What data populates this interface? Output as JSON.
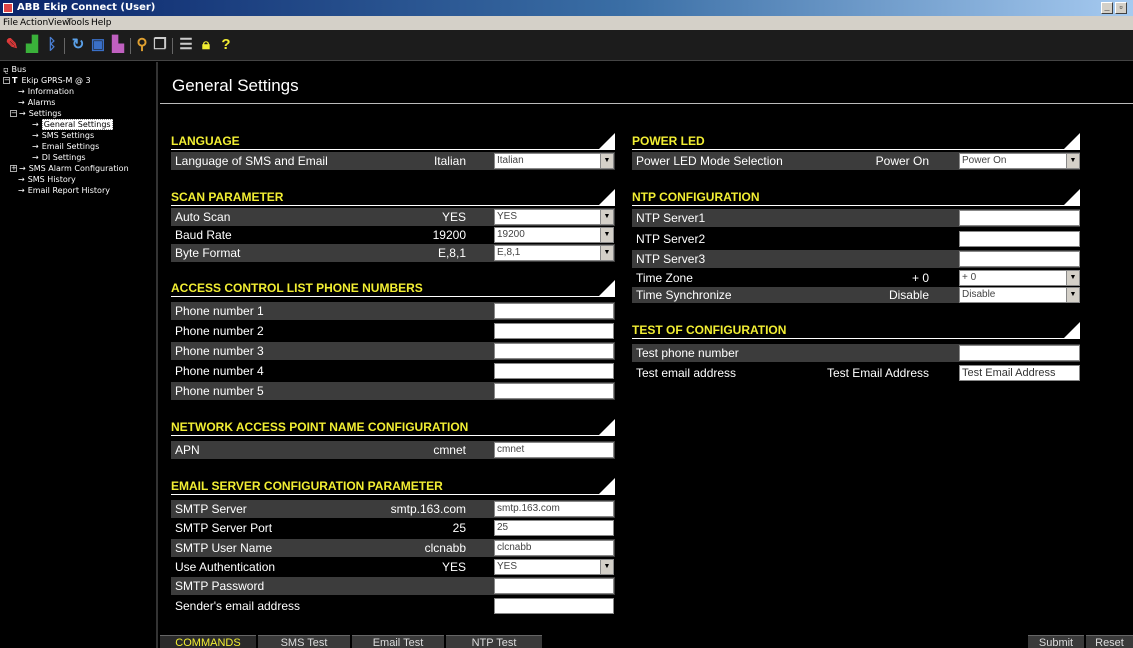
{
  "window": {
    "title": "ABB Ekip Connect (User)",
    "min_btn": "_",
    "max_btn": "▫"
  },
  "menu": [
    "File",
    "Action",
    "View",
    "Tools",
    "Help"
  ],
  "toolbar_icons": [
    "pencil-icon",
    "network-icon",
    "bluetooth-icon",
    "refresh-icon",
    "save-icon",
    "print-icon",
    "search-icon",
    "copy-icon",
    "list-icon",
    "lock-icon",
    "help-icon"
  ],
  "tree": {
    "root": "Bus",
    "device": "Ekip GPRS-M @ 3",
    "device_prefix": "T",
    "items": {
      "information": "Information",
      "alarms": "Alarms",
      "settings": "Settings",
      "general_settings": "General Settings",
      "sms_settings": "SMS Settings",
      "email_settings": "Email Settings",
      "di_settings": "DI Settings",
      "sms_alarm_config": "SMS Alarm Configuration",
      "sms_history": "SMS History",
      "email_report_history": "Email Report History"
    }
  },
  "page": {
    "title": "General Settings"
  },
  "language": {
    "title": "LANGUAGE",
    "label": "Language of SMS and Email",
    "value": "Italian",
    "selected": "Italian"
  },
  "scan": {
    "title": "SCAN PARAMETER",
    "rows": [
      {
        "label": "Auto Scan",
        "value": "YES",
        "selected": "YES"
      },
      {
        "label": "Baud Rate",
        "value": "19200",
        "selected": "19200"
      },
      {
        "label": "Byte Format",
        "value": "E,8,1",
        "selected": "E,8,1"
      }
    ]
  },
  "acl": {
    "title": "ACCESS CONTROL LIST PHONE NUMBERS",
    "rows": [
      "Phone number 1",
      "Phone number 2",
      "Phone number 3",
      "Phone number 4",
      "Phone number 5"
    ]
  },
  "apn": {
    "title": "NETWORK ACCESS POINT NAME CONFIGURATION",
    "label": "APN",
    "value": "cmnet",
    "input": "cmnet"
  },
  "email_server": {
    "title": "EMAIL SERVER CONFIGURATION PARAMETER",
    "smtp_server": {
      "label": "SMTP Server",
      "value": "smtp.163.com",
      "input": "smtp.163.com"
    },
    "smtp_port": {
      "label": "SMTP Server Port",
      "value": "25",
      "input": "25"
    },
    "smtp_user": {
      "label": "SMTP User Name",
      "value": "clcnabb",
      "input": "clcnabb"
    },
    "use_auth": {
      "label": "Use Authentication",
      "value": "YES",
      "selected": "YES"
    },
    "smtp_password": {
      "label": "SMTP Password"
    },
    "sender": {
      "label": "Sender's email address"
    }
  },
  "power_led": {
    "title": "POWER LED",
    "label": "Power LED Mode Selection",
    "value": "Power On",
    "selected": "Power On"
  },
  "ntp": {
    "title": "NTP CONFIGURATION",
    "server1": "NTP Server1",
    "server2": "NTP Server2",
    "server3": "NTP Server3",
    "timezone": {
      "label": "Time Zone",
      "value": "+ 0",
      "selected": "+ 0"
    },
    "timesync": {
      "label": "Time Synchronize",
      "value": "Disable",
      "selected": "Disable"
    }
  },
  "test_config": {
    "title": "TEST OF CONFIGURATION",
    "phone": {
      "label": "Test phone number"
    },
    "email": {
      "label": "Test email address",
      "value": "Test Email Address",
      "input": "Test Email Address"
    }
  },
  "bottom": {
    "commands": "COMMANDS",
    "sms_test": "SMS Test",
    "email_test": "Email Test",
    "ntp_test": "NTP Test",
    "submit": "Submit",
    "reset": "Reset"
  }
}
